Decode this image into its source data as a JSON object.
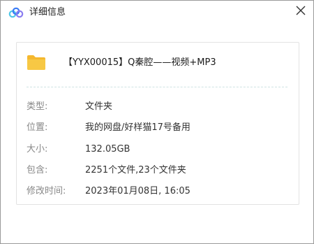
{
  "window": {
    "title": "详细信息",
    "icon": "cloud-logo-icon",
    "close_icon": "close-icon"
  },
  "file": {
    "name": "【YYX00015】Q秦腔——视频+MP3",
    "icon": "folder-icon",
    "icon_color": "#f7c844"
  },
  "details": {
    "type_label": "类型:",
    "type_value": "文件夹",
    "location_label": "位置:",
    "location_value": "我的网盘/好样猫17号备用",
    "size_label": "大小:",
    "size_value": "132.05GB",
    "contains_label": "包含:",
    "contains_value": "2251个文件,23个文件夹",
    "modified_label": "修改时间:",
    "modified_value": "2023年01月08日, 16:05"
  },
  "colors": {
    "logo_blue": "#3b7cf6",
    "logo_cyan": "#4fc7e8",
    "logo_purple": "#8a7cf0",
    "label_gray": "#888888",
    "divider": "#cfe3e3"
  }
}
